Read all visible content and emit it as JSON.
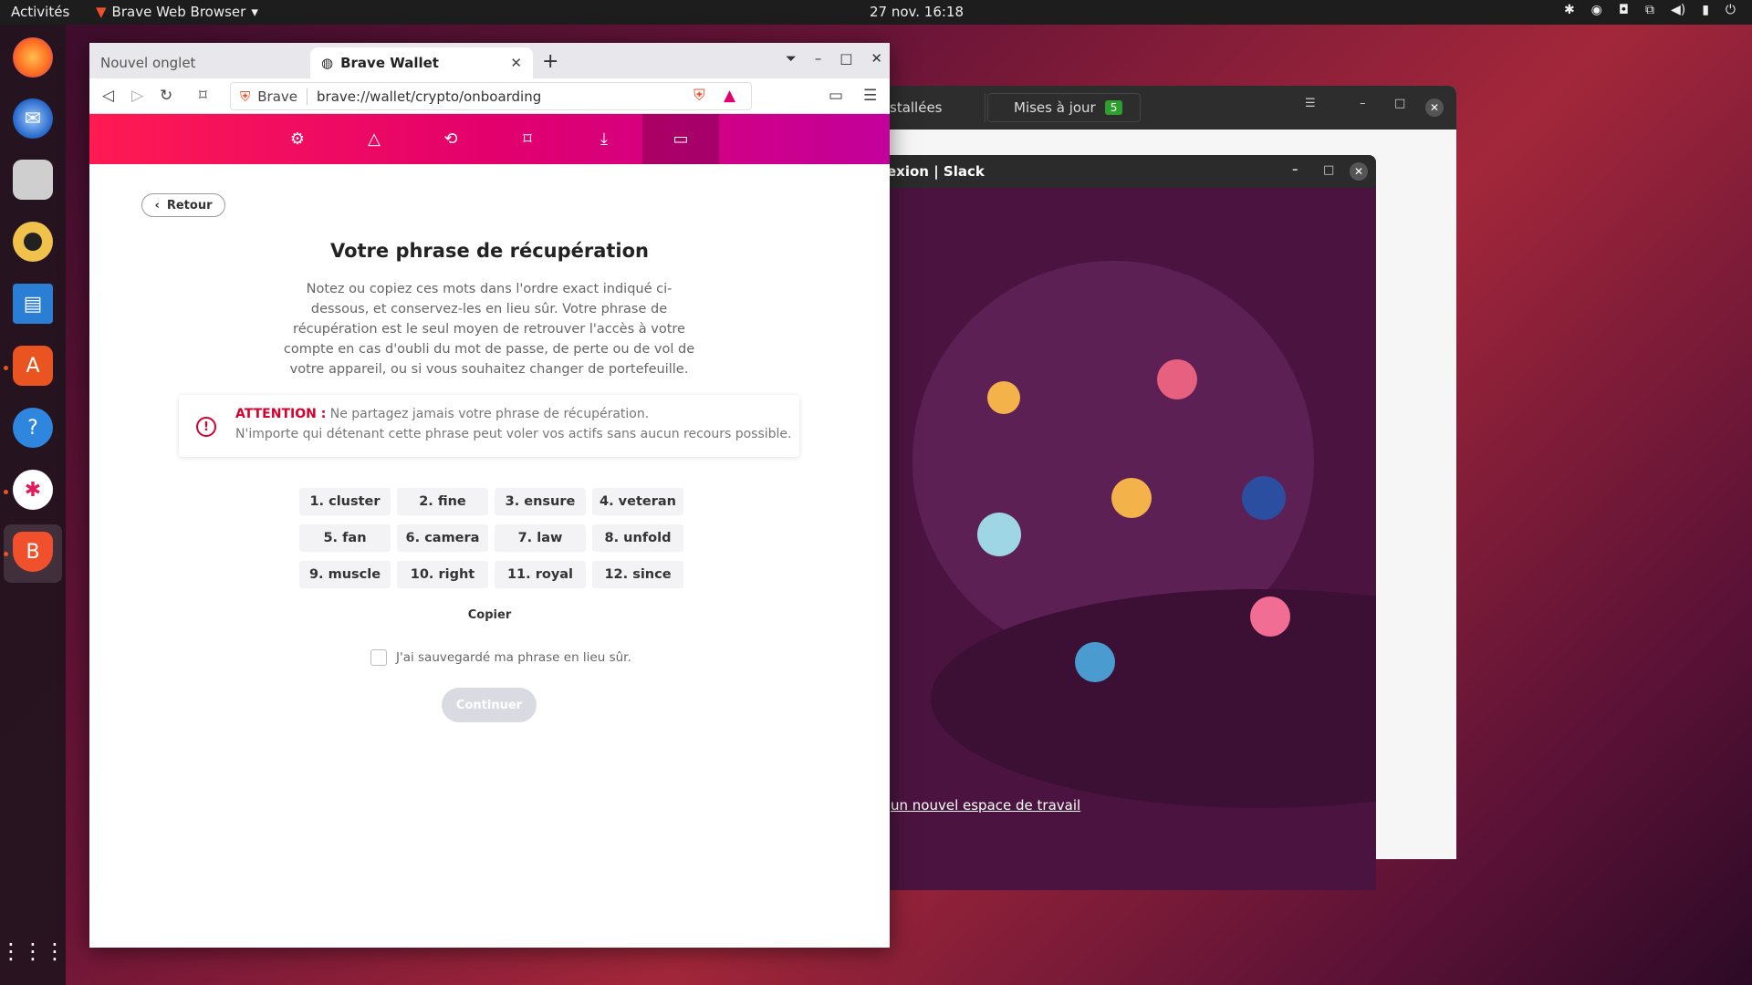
{
  "topbar": {
    "activities": "Activités",
    "app_name": "Brave Web Browser",
    "clock": "27 nov.  16:18"
  },
  "dock": {
    "items": [
      "firefox-icon",
      "thunderbird-icon",
      "files-icon",
      "rhythmbox-icon",
      "writer-icon",
      "app-center-icon",
      "help-icon",
      "slack-icon",
      "brave-icon",
      "apps-grid-icon"
    ]
  },
  "bg_software": {
    "tab_installed": "stallées",
    "tab_updates": "Mises à jour",
    "updates_count": "5"
  },
  "bg_slack": {
    "title": "exion | Slack",
    "link": "un nouvel espace de travail"
  },
  "browser": {
    "tab_inactive": "Nouvel onglet",
    "tab_active": "Brave Wallet",
    "url_brave": "Brave",
    "url": "brave://wallet/crypto/onboarding"
  },
  "wallet": {
    "back_label": "Retour",
    "title": "Votre phrase de récupération",
    "description": "Notez ou copiez ces mots dans l'ordre exact indiqué ci-dessous, et conservez-les en lieu sûr. Votre phrase de récupération est le seul moyen de retrouver l'accès à votre compte en cas d'oubli du mot de passe, de perte ou de vol de votre appareil, ou si vous souhaitez changer de portefeuille.",
    "warning_label": "ATTENTION :",
    "warning_line1": " Ne partagez jamais votre phrase de récupération.",
    "warning_line2": "N'importe qui détenant cette phrase peut voler vos actifs sans aucun recours possible.",
    "words": [
      "1. cluster",
      "2. fine",
      "3. ensure",
      "4. veteran",
      "5. fan",
      "6. camera",
      "7. law",
      "8. unfold",
      "9. muscle",
      "10. right",
      "11. royal",
      "12. since"
    ],
    "copy_label": "Copier",
    "confirm_label": "J'ai sauvegardé ma phrase en lieu sûr.",
    "continue_label": "Continuer"
  },
  "colors": {
    "accent": "#e3006d",
    "warning": "#d6002e"
  }
}
